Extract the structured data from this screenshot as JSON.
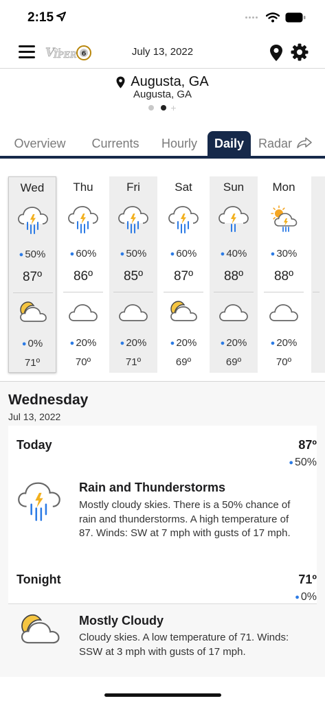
{
  "status_bar": {
    "time": "2:15"
  },
  "header": {
    "date": "July 13, 2022"
  },
  "location": {
    "title": "Augusta, GA",
    "subtitle": "Augusta, GA"
  },
  "tabs": [
    {
      "label": "Overview"
    },
    {
      "label": "Currents"
    },
    {
      "label": "Hourly"
    },
    {
      "label": "Daily"
    },
    {
      "label": "Radar"
    }
  ],
  "days": [
    {
      "name": "Wed",
      "day_pct": "50%",
      "hi": "87º",
      "night_pct": "0%",
      "lo": "71º",
      "day_icon": "thunderstorm-icon",
      "night_icon": "partly-cloudy-night-icon"
    },
    {
      "name": "Thu",
      "day_pct": "60%",
      "hi": "86º",
      "night_pct": "20%",
      "lo": "70º",
      "day_icon": "thunderstorm-icon",
      "night_icon": "cloudy-icon"
    },
    {
      "name": "Fri",
      "day_pct": "50%",
      "hi": "85º",
      "night_pct": "20%",
      "lo": "71º",
      "day_icon": "thunderstorm-icon",
      "night_icon": "cloudy-icon"
    },
    {
      "name": "Sat",
      "day_pct": "60%",
      "hi": "87º",
      "night_pct": "20%",
      "lo": "69º",
      "day_icon": "thunderstorm-icon",
      "night_icon": "partly-cloudy-night-icon"
    },
    {
      "name": "Sun",
      "day_pct": "40%",
      "hi": "88º",
      "night_pct": "20%",
      "lo": "69º",
      "day_icon": "thunderstorm-icon",
      "night_icon": "cloudy-icon"
    },
    {
      "name": "Mon",
      "day_pct": "30%",
      "hi": "88º",
      "night_pct": "20%",
      "lo": "70º",
      "day_icon": "partly-sunny-showers-icon",
      "night_icon": "cloudy-icon"
    }
  ],
  "detail": {
    "day": "Wednesday",
    "date": "Jul 13, 2022",
    "periods": [
      {
        "label": "Today",
        "temp": "87º",
        "pct": "50%",
        "condition": "Rain and Thunderstorms",
        "text": "Mostly cloudy skies. There is a 50% chance of rain and thunderstorms.  A high temperature of 87.  Winds: SW at 7 mph with gusts of 17 mph.",
        "icon": "thunderstorm-icon"
      },
      {
        "label": "Tonight",
        "temp": "71º",
        "pct": "0%",
        "condition": "Mostly Cloudy",
        "text": "Cloudy skies.  A low temperature of 71.  Winds: SSW at 3 mph with gusts of 17 mph.",
        "icon": "partly-cloudy-night-icon"
      }
    ]
  },
  "colors": {
    "accent": "#16294a",
    "drop": "#2c7be5",
    "bolt": "#f2b01e",
    "rain": "#2c7be5",
    "moon": "#f5c542"
  }
}
